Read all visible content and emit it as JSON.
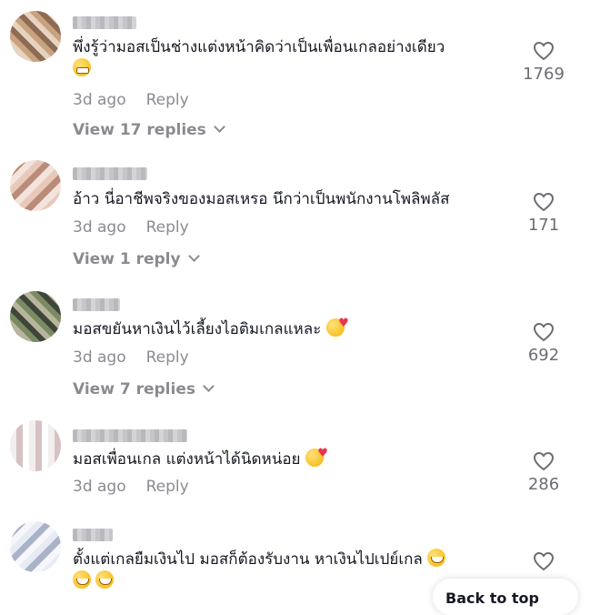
{
  "comments": [
    {
      "text": "พึ่งรู้ว่ามอสเป็นช่างแต่งหน้าคิดว่าเป็นเพื่อนเกลอย่างเดียว",
      "emoji": "beaming-face-emoji",
      "time": "3d ago",
      "reply_label": "Reply",
      "likes": "1769",
      "view_replies": "View 17 replies"
    },
    {
      "text": "อ้าว นี่อาชีพจริงของมอสเหรอ นึกว่าเป็นพนักงานโพลิพลัส",
      "time": "3d ago",
      "reply_label": "Reply",
      "likes": "171",
      "view_replies": "View 1 reply"
    },
    {
      "text": "มอสขยันหาเงินไว้เลี้ยงไอติมเกลแหละ",
      "emoji": "smiling-face-with-hearts-emoji",
      "time": "3d ago",
      "reply_label": "Reply",
      "likes": "692",
      "view_replies": "View 7 replies"
    },
    {
      "text": "มอสเพื่อนเกล แต่งหน้าได้นิดหน่อย",
      "emoji": "smiling-face-with-hearts-emoji",
      "time": "3d ago",
      "reply_label": "Reply",
      "likes": "286"
    },
    {
      "text": "ตั้งแต่เกลยืมเงินไป มอสก็ต้องรับงาน หาเงินไปเปย์เกล",
      "emoji": "tears-of-joy-emoji"
    }
  ],
  "overlay": {
    "label": "Back to top"
  }
}
